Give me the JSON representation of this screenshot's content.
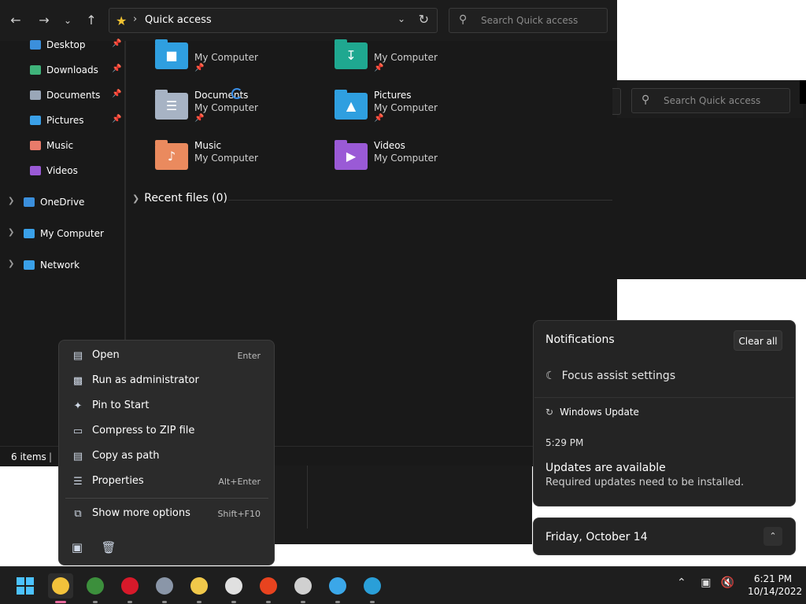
{
  "explorer": {
    "address": "Quick access",
    "search_placeholder": "Search Quick access",
    "sidebar": [
      {
        "label": "Desktop",
        "pinned": true,
        "color": "#3b8fdc"
      },
      {
        "label": "Downloads",
        "pinned": true,
        "color": "#3fb37a"
      },
      {
        "label": "Documents",
        "pinned": true,
        "color": "#9aa7b8"
      },
      {
        "label": "Pictures",
        "pinned": true,
        "color": "#3aa0e8"
      },
      {
        "label": "Music",
        "pinned": false,
        "color": "#e97b6a"
      },
      {
        "label": "Videos",
        "pinned": false,
        "color": "#9a5ad6"
      },
      {
        "label": "OneDrive",
        "pinned": false,
        "color": "#3b8fdc"
      },
      {
        "label": "My Computer",
        "pinned": false,
        "color": "#3aa0e8"
      },
      {
        "label": "Network",
        "pinned": false,
        "color": "#3aa0e8"
      }
    ],
    "folders": [
      {
        "name": "",
        "location": "My Computer",
        "pinned": true,
        "color": "#2f9fe0",
        "icon": "desktop-folder-icon"
      },
      {
        "name": "",
        "location": "My Computer",
        "pinned": true,
        "color": "#1fa890",
        "icon": "downloads-folder-icon"
      },
      {
        "name": "Documents",
        "location": "My Computer",
        "pinned": true,
        "color": "#a7b3c4",
        "icon": "documents-folder-icon"
      },
      {
        "name": "Pictures",
        "location": "My Computer",
        "pinned": true,
        "color": "#2f9fe0",
        "icon": "pictures-folder-icon"
      },
      {
        "name": "Music",
        "location": "My Computer",
        "pinned": false,
        "color": "#ea8a5e",
        "icon": "music-folder-icon"
      },
      {
        "name": "Videos",
        "location": "My Computer",
        "pinned": false,
        "color": "#9a5ad6",
        "icon": "videos-folder-icon"
      }
    ],
    "recent_label": "Recent files (0)",
    "status": "6 items"
  },
  "window2": {
    "search_placeholder": "Search Quick access"
  },
  "context_menu": {
    "items": [
      {
        "label": "Open",
        "shortcut": "Enter",
        "icon": "open-icon"
      },
      {
        "label": "Run as administrator",
        "shortcut": "",
        "icon": "shield-icon"
      },
      {
        "label": "Pin to Start",
        "shortcut": "",
        "icon": "pin-icon"
      },
      {
        "label": "Compress to ZIP file",
        "shortcut": "",
        "icon": "zip-icon"
      },
      {
        "label": "Copy as path",
        "shortcut": "",
        "icon": "copy-path-icon"
      },
      {
        "label": "Properties",
        "shortcut": "Alt+Enter",
        "icon": "properties-icon"
      }
    ],
    "more": {
      "label": "Show more options",
      "shortcut": "Shift+F10",
      "icon": "more-options-icon"
    }
  },
  "notifications": {
    "title": "Notifications",
    "clear_all": "Clear all",
    "focus_assist": "Focus assist settings",
    "app": "Windows Update",
    "time": "5:29 PM",
    "heading": "Updates are available",
    "body": "Required updates need to be installed."
  },
  "calendar": {
    "date": "Friday, October 14"
  },
  "taskbar": {
    "apps": [
      {
        "name": "file-explorer",
        "color": "#f2c23b",
        "active": true
      },
      {
        "name": "chrome",
        "color": "#3c8f3c",
        "active": false
      },
      {
        "name": "opera",
        "color": "#d7192a",
        "active": false
      },
      {
        "name": "settings",
        "color": "#8a96a8",
        "active": false
      },
      {
        "name": "file-manager",
        "color": "#f0c84a",
        "active": false
      },
      {
        "name": "java",
        "color": "#e0e0e0",
        "active": false
      },
      {
        "name": "office",
        "color": "#e8431f",
        "active": false
      },
      {
        "name": "clock-app",
        "color": "#d0d0d0",
        "active": false
      },
      {
        "name": "tips",
        "color": "#3ba7e8",
        "active": false
      },
      {
        "name": "edge",
        "color": "#2a9fd8",
        "active": false
      }
    ],
    "time": "6:21 PM",
    "date": "10/14/2022"
  }
}
